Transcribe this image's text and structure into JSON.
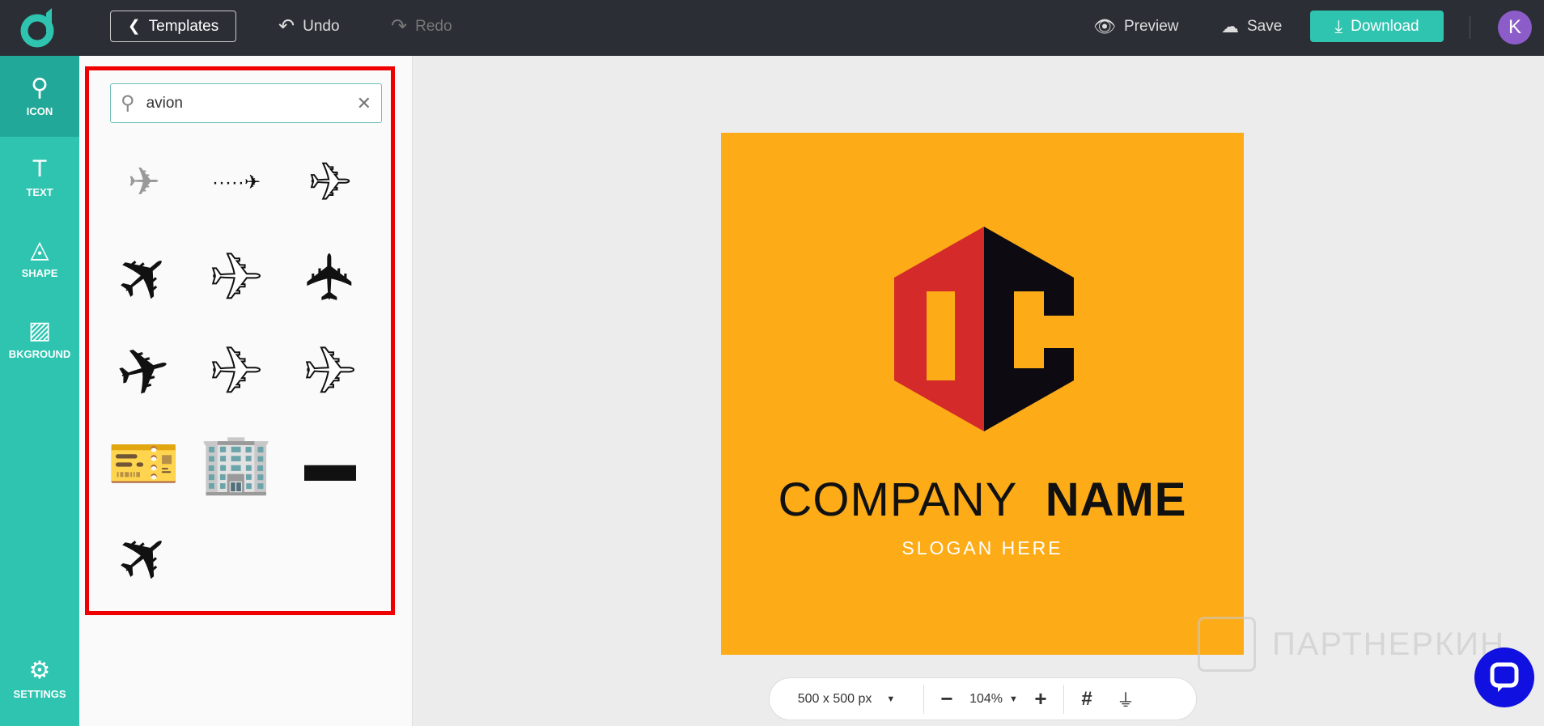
{
  "topbar": {
    "templates": "Templates",
    "undo": "Undo",
    "redo": "Redo",
    "preview": "Preview",
    "save": "Save",
    "download": "Download",
    "avatar": "K"
  },
  "sidebar": {
    "items": [
      {
        "label": "ICON",
        "icon": "⚲"
      },
      {
        "label": "TEXT",
        "icon": "T"
      },
      {
        "label": "SHAPE",
        "icon": "◬"
      },
      {
        "label": "BKGROUND",
        "icon": "▨"
      },
      {
        "label": "SETTINGS",
        "icon": "⚙"
      }
    ]
  },
  "panel": {
    "search_value": "avion",
    "icons": [
      "biplane",
      "plane-dotted-route",
      "plane-outline",
      "plane-solid-diagonal",
      "fighter-plane-outline",
      "plane-solid-topdown",
      "plane-takeoff",
      "plane-side-outline",
      "jet-outline",
      "boarding-ticket",
      "airport-tower",
      "plane-side-solid",
      "plane-solid"
    ]
  },
  "canvas": {
    "company": "COMPANY",
    "name": "NAME",
    "slogan": "SLOGAN HERE",
    "bg": "#fdac18",
    "red": "#d42a2a",
    "dark": "#0d0a12"
  },
  "bottombar": {
    "size": "500 x 500 px",
    "zoom": "104%"
  },
  "watermark": "ПАРТНЕРКИН"
}
